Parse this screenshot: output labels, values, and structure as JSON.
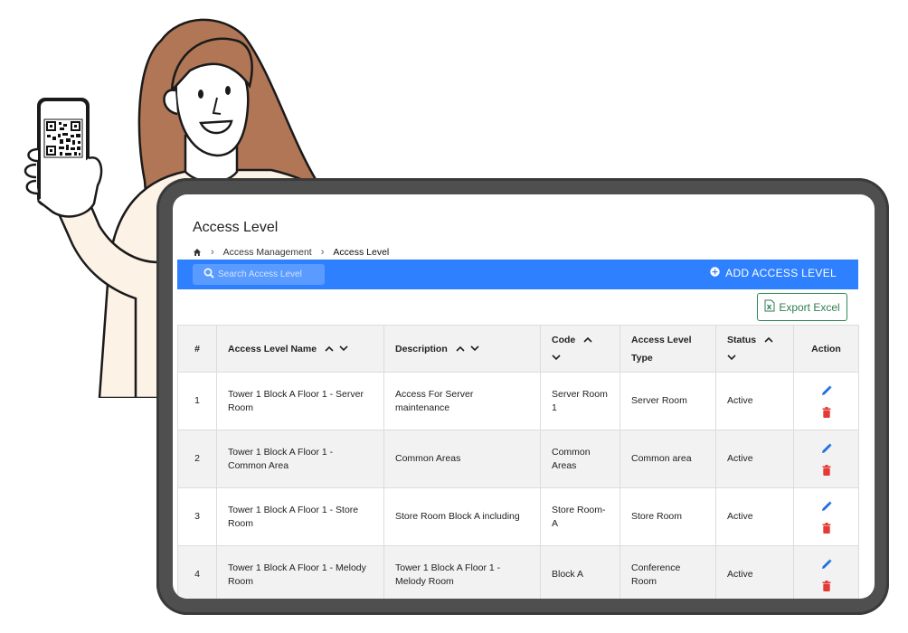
{
  "page": {
    "title": "Access Level",
    "breadcrumb": {
      "parent": "Access Management",
      "current": "Access Level"
    }
  },
  "toolbar": {
    "search_placeholder": "Search Access Level",
    "add_button": "ADD ACCESS LEVEL",
    "export_button": "Export Excel"
  },
  "table": {
    "headers": {
      "num": "#",
      "name": "Access Level Name",
      "description": "Description",
      "code": "Code",
      "type": "Access Level Type",
      "status": "Status",
      "action": "Action"
    },
    "rows": [
      {
        "num": "1",
        "name": "Tower 1 Block A Floor 1 - Server Room",
        "description": "Access For Server maintenance",
        "code": "Server Room 1",
        "type": "Server Room",
        "status": "Active"
      },
      {
        "num": "2",
        "name": "Tower 1 Block A Floor 1 - Common Area",
        "description": "Common Areas",
        "code": "Common Areas",
        "type": "Common area",
        "status": "Active"
      },
      {
        "num": "3",
        "name": "Tower 1 Block A Floor 1 - Store Room",
        "description": "Store Room Block A including",
        "code": "Store Room-A",
        "type": "Store Room",
        "status": "Active"
      },
      {
        "num": "4",
        "name": "Tower 1 Block A Floor 1 - Melody Room",
        "description": "Tower 1 Block A Floor 1 - Melody Room",
        "code": "Block A",
        "type": "Conference Room",
        "status": "Active"
      }
    ]
  },
  "icons": {
    "home": "home-icon",
    "chevron": "chevron-right-icon",
    "search": "search-icon",
    "add": "plus-circle-icon",
    "excel": "excel-icon",
    "sort_up": "chevron-up-icon",
    "sort_down": "chevron-down-icon",
    "edit": "pencil-icon",
    "delete": "trash-icon"
  },
  "colors": {
    "toolbar": "#2f80ff",
    "edit_icon": "#1e6fe0",
    "delete_icon": "#e53935",
    "export_border": "#2e8b57",
    "tablet_frame": "#4f4f4f"
  }
}
